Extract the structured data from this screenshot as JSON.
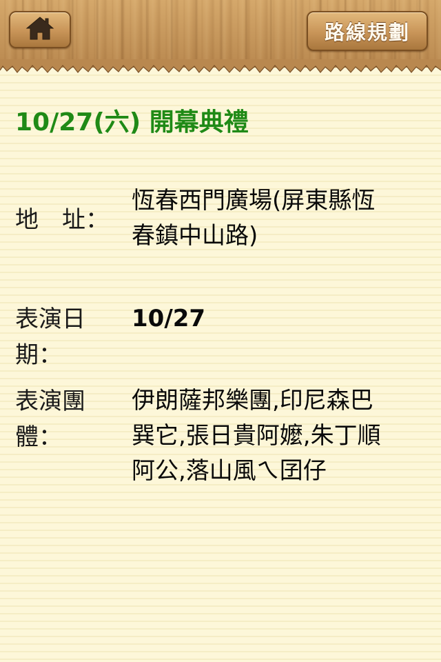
{
  "header": {
    "home_icon": "home-icon",
    "route_button_label": "路線規劃"
  },
  "event": {
    "title": "10/27(六) 開幕典禮",
    "address_label": "地　址：",
    "address_value": "恆春西門廣場(屏東縣恆春鎮中山路)",
    "date_label": "表演日期：",
    "date_value": "10/27",
    "group_label": "表演團體：",
    "group_value": "伊朗薩邦樂團,印尼森巴巽它,張日貴阿嬤,朱丁順阿公,落山風ㄟ囝仔"
  },
  "colors": {
    "title_green": "#1f8a16",
    "wood": "#c99a5e",
    "paper": "#fdf7d8"
  }
}
